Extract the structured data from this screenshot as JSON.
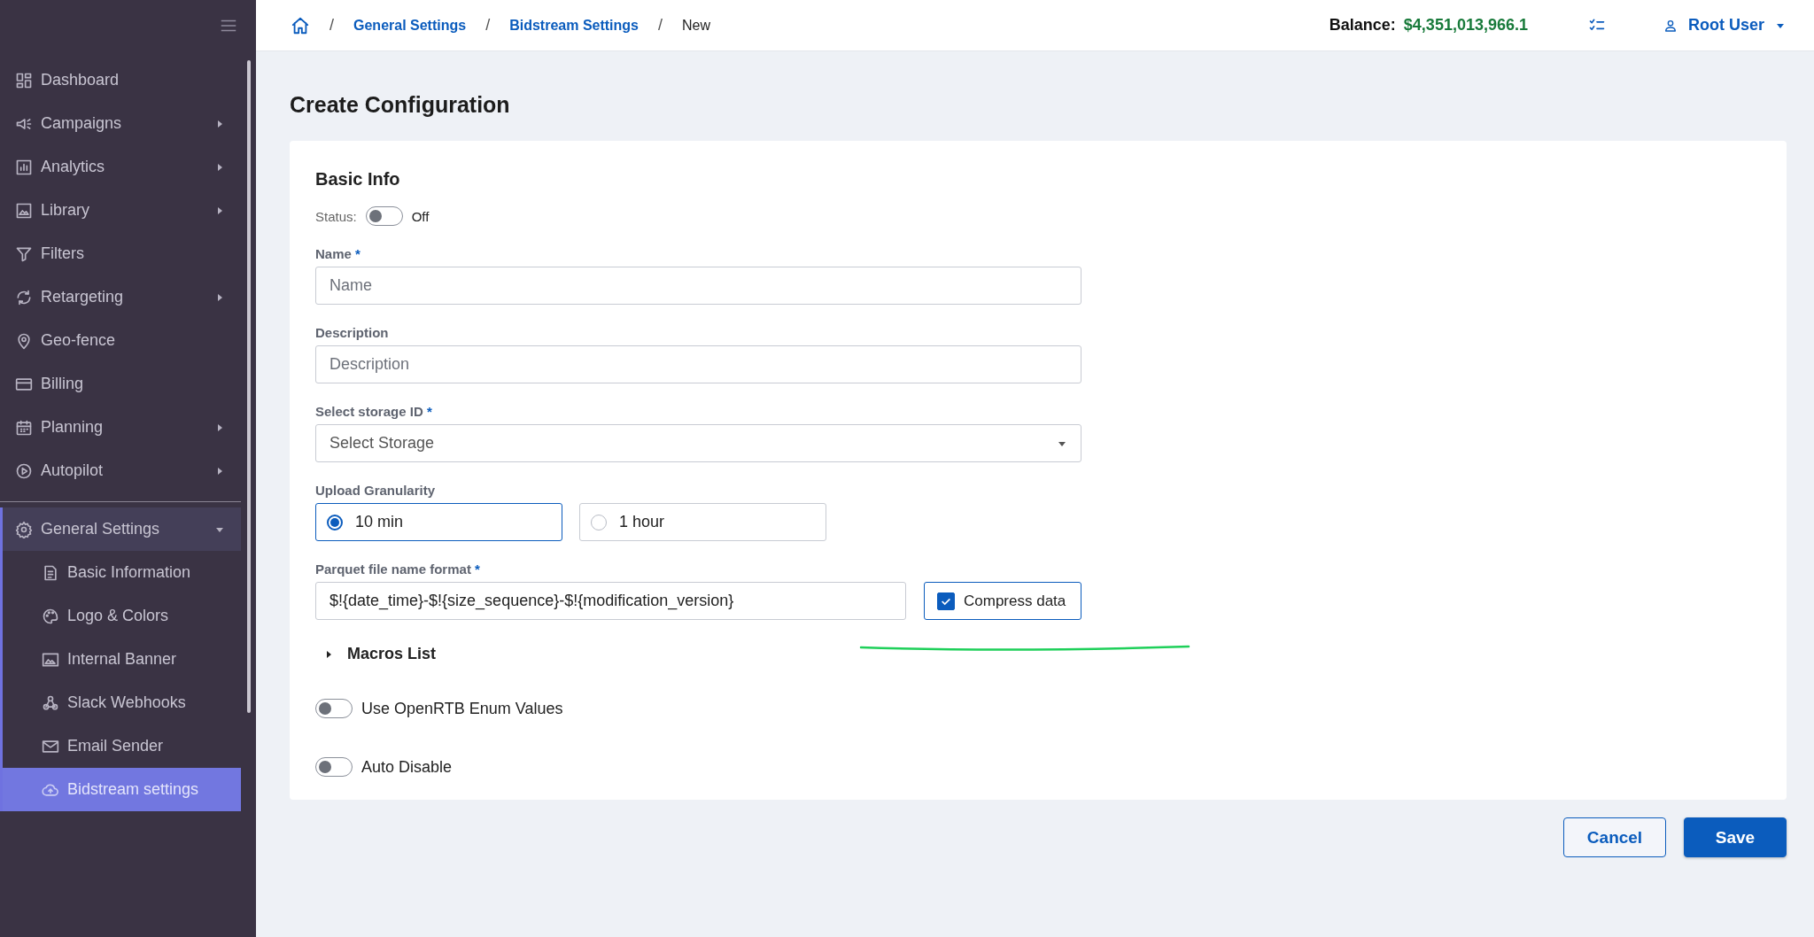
{
  "sidebar": {
    "items": [
      {
        "label": "Dashboard",
        "has_submenu": false
      },
      {
        "label": "Campaigns",
        "has_submenu": true
      },
      {
        "label": "Analytics",
        "has_submenu": true
      },
      {
        "label": "Library",
        "has_submenu": true
      },
      {
        "label": "Filters",
        "has_submenu": false
      },
      {
        "label": "Retargeting",
        "has_submenu": true
      },
      {
        "label": "Geo-fence",
        "has_submenu": false
      },
      {
        "label": "Billing",
        "has_submenu": false
      },
      {
        "label": "Planning",
        "has_submenu": true
      },
      {
        "label": "Autopilot",
        "has_submenu": true
      },
      {
        "label": "General Settings",
        "has_submenu": true,
        "expanded": true,
        "children": [
          {
            "label": "Basic Information",
            "selected": false
          },
          {
            "label": "Logo & Colors",
            "selected": false
          },
          {
            "label": "Internal Banner",
            "selected": false
          },
          {
            "label": "Slack Webhooks",
            "selected": false
          },
          {
            "label": "Email Sender",
            "selected": false
          },
          {
            "label": "Bidstream settings",
            "selected": true
          }
        ]
      }
    ]
  },
  "header": {
    "breadcrumb": {
      "separator": "/",
      "items": [
        "General Settings",
        "Bidstream Settings",
        "New"
      ]
    },
    "balance_label": "Balance:",
    "balance": "$4,351,013,966.1",
    "user": "Root User"
  },
  "page": {
    "title": "Create Configuration",
    "section": "Basic Info",
    "status": {
      "label": "Status:",
      "on": false,
      "text": "Off"
    },
    "fields": [
      {
        "kind": "input",
        "label": "Name",
        "required_mark": "*",
        "placeholder": "Name"
      },
      {
        "kind": "input",
        "label": "Description",
        "placeholder": "Description"
      },
      {
        "kind": "select",
        "label": "Select storage ID",
        "required_mark": "*",
        "placeholder": "Select Storage"
      },
      {
        "kind": "radio",
        "label": "Upload Granularity",
        "options": [
          {
            "label": "10 min",
            "selected": true
          },
          {
            "label": "1 hour",
            "selected": false
          }
        ]
      },
      {
        "kind": "input_check",
        "label": "Parquet file name format",
        "required_mark": "*",
        "value": "$!{date_time}-$!{size_sequence}-$!{modification_version}",
        "check": {
          "label": "Compress data",
          "checked": true
        }
      }
    ],
    "macros": {
      "label": "Macros List",
      "expanded": false
    },
    "toggles": [
      {
        "label": "Use OpenRTB Enum Values",
        "on": false
      },
      {
        "label": "Auto Disable",
        "on": false
      }
    ],
    "buttons": [
      {
        "kind": "secondary",
        "label": "Cancel"
      },
      {
        "kind": "primary",
        "label": "Save"
      }
    ]
  }
}
